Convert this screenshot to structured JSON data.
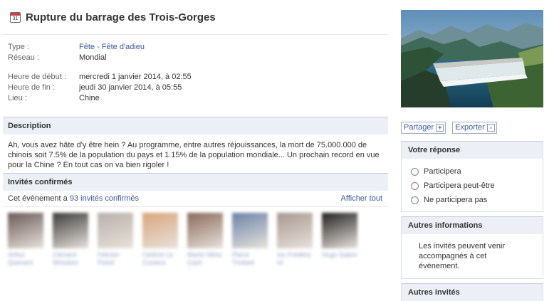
{
  "event": {
    "calendar_day": "31",
    "title": "Rupture du barrage des Trois-Gorges",
    "info": [
      {
        "label": "Type :",
        "value": "Fête - Fête d'adieu",
        "link": true
      },
      {
        "label": "Réseau :",
        "value": "Mondial",
        "link": false
      },
      {
        "label": "Heure de début :",
        "value": "mercredi 1 janvier 2014, à 02:55",
        "link": false
      },
      {
        "label": "Heure de fin :",
        "value": "jeudi 30 janvier 2014, à 05:55",
        "link": false
      },
      {
        "label": "Lieu :",
        "value": "Chine",
        "link": false
      }
    ]
  },
  "description": {
    "heading": "Description",
    "text": "Ah, vous avez hâte d'y être hein ? Au programme, entre autres réjouissances, la mort de 75.000.000 de chinois soit 7.5% de la population du pays et 1.15% de la population mondiale... Un prochain record en vue pour la Chine ? En tout cas on va bien rigoler !"
  },
  "guests": {
    "heading": "Invités confirmés",
    "count_prefix": "Cet évènement a ",
    "count_link": "93 invités confirmés",
    "show_all": "Afficher tout",
    "list": [
      {
        "name": "Arthur Quenard",
        "color": "#6a5a58"
      },
      {
        "name": "Clément Wrestem Plains",
        "color": "#3c3c3c"
      },
      {
        "name": "Félicien Poiret",
        "color": "#b8b0a8"
      },
      {
        "name": "Cédrick Le Cunieux Crayon",
        "color": "#d9a67c"
      },
      {
        "name": "Martin Méra Cash Sévera",
        "color": "#8a6a5a"
      },
      {
        "name": "Pierre Trottard",
        "color": "#6b84a8"
      },
      {
        "name": "Ion Frédéric Ivi",
        "color": "#a89890"
      },
      {
        "name": "Hugo Salem",
        "color": "#222222"
      }
    ]
  },
  "actions": {
    "share": "Partager",
    "export": "Exporter"
  },
  "rsvp": {
    "heading": "Votre réponse",
    "options": [
      "Participera",
      "Participera peut-être",
      "Ne participera pas"
    ]
  },
  "other_info": {
    "heading": "Autres informations",
    "text": "Les invités peuvent venir accompagnés à cet évènement."
  },
  "other_guests": {
    "heading": "Autres invités"
  }
}
